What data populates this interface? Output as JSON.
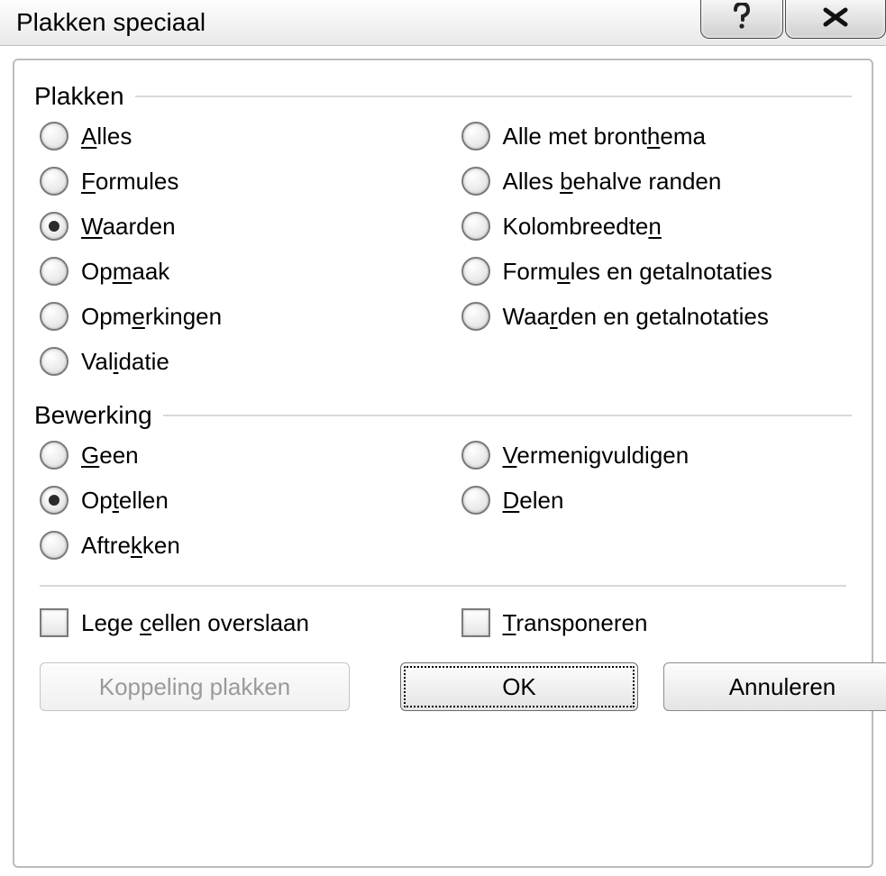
{
  "title": "Plakken speciaal",
  "plakken": {
    "header": "Plakken",
    "selected": "waarden",
    "left": [
      {
        "key": "alles",
        "pre": "",
        "u": "A",
        "post": "lles"
      },
      {
        "key": "formules",
        "pre": "",
        "u": "F",
        "post": "ormules"
      },
      {
        "key": "waarden",
        "pre": "",
        "u": "W",
        "post": "aarden"
      },
      {
        "key": "opmaak",
        "pre": "Op",
        "u": "m",
        "post": "aak"
      },
      {
        "key": "opmerkingen",
        "pre": "Opm",
        "u": "e",
        "post": "rkingen"
      },
      {
        "key": "validatie",
        "pre": "Val",
        "u": "i",
        "post": "datie"
      }
    ],
    "right": [
      {
        "key": "bronthema",
        "pre": "Alle met bront",
        "u": "h",
        "post": "ema"
      },
      {
        "key": "behalve",
        "pre": "Alles ",
        "u": "b",
        "post": "ehalve randen"
      },
      {
        "key": "kolombreedten",
        "pre": "Kolombreedte",
        "u": "n",
        "post": ""
      },
      {
        "key": "form_getal",
        "pre": "Form",
        "u": "u",
        "post": "les en getalnotaties"
      },
      {
        "key": "waard_getal",
        "pre": "Waa",
        "u": "r",
        "post": "den en getalnotaties"
      }
    ]
  },
  "bewerking": {
    "header": "Bewerking",
    "selected": "optellen",
    "left": [
      {
        "key": "geen",
        "pre": "",
        "u": "G",
        "post": "een"
      },
      {
        "key": "optellen",
        "pre": "Op",
        "u": "t",
        "post": "ellen"
      },
      {
        "key": "aftrekken",
        "pre": "Aftre",
        "u": "k",
        "post": "ken"
      }
    ],
    "right": [
      {
        "key": "vermenigvuldigen",
        "pre": "",
        "u": "V",
        "post": "ermenigvuldigen"
      },
      {
        "key": "delen",
        "pre": "",
        "u": "D",
        "post": "elen"
      }
    ]
  },
  "checks": {
    "skip_blanks": {
      "checked": false,
      "pre": "Lege ",
      "u": "c",
      "post": "ellen overslaan"
    },
    "transpose": {
      "checked": false,
      "pre": "",
      "u": "T",
      "post": "ransponeren"
    }
  },
  "buttons": {
    "paste_link": "Koppeling plakken",
    "ok": "OK",
    "cancel": "Annuleren"
  }
}
